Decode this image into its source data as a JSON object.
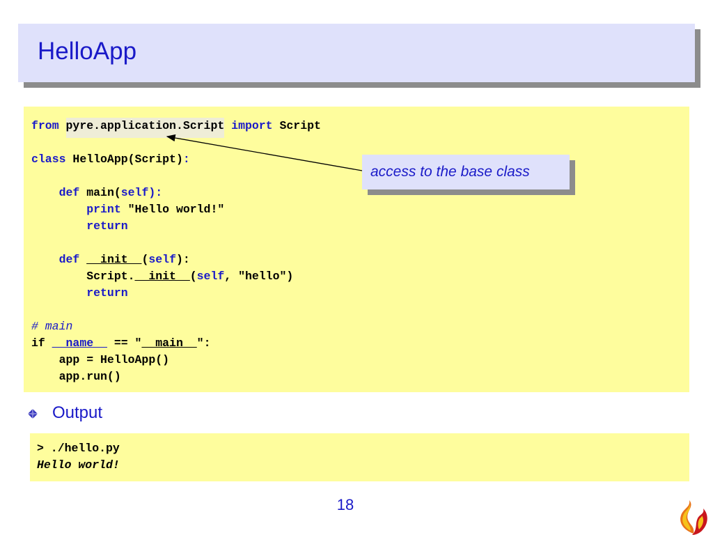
{
  "slide": {
    "title": "HelloApp",
    "page_number": "18",
    "output_label": "Output",
    "callout": "access to the base class"
  },
  "code": {
    "l1_from": "from",
    "l1_module": "pyre.application.Script",
    "l1_import": "import",
    "l1_name": "Script",
    "l3_class": "class",
    "l3_decl": "HelloApp(Script)",
    "l3_colon": ":",
    "l5_def": "def",
    "l5_name": "main(",
    "l5_self": "self",
    "l5_end": "):",
    "l6_print": "print",
    "l6_str": "\"Hello world!\"",
    "l7_return": "return",
    "l9_def": "def",
    "l9_name": "__init__",
    "l9_open": "(",
    "l9_self": "self",
    "l9_end": "):",
    "l10_call": "__init__",
    "l10_prefix": "Script.",
    "l10_open": "(",
    "l10_self": "self",
    "l10_rest": ", \"hello\")",
    "l11_return": "return",
    "l13_comment": "# main",
    "l14_if": "if",
    "l14_name": "__name__",
    "l14_eq": " == \"",
    "l14_main": "__main__",
    "l14_end": "\":",
    "l15": "app = HelloApp()",
    "l16": "app.run()"
  },
  "output": {
    "command": "> ./hello.py",
    "result": "Hello world!"
  },
  "colors": {
    "title_blue": "#1a1ac8",
    "code_bg": "#fefd9d",
    "title_bg": "#dfe1fb",
    "shadow": "#8c8c8c"
  },
  "icons": {
    "bullet": "diamond-bullet-icon",
    "logo": "flame-logo-icon"
  }
}
